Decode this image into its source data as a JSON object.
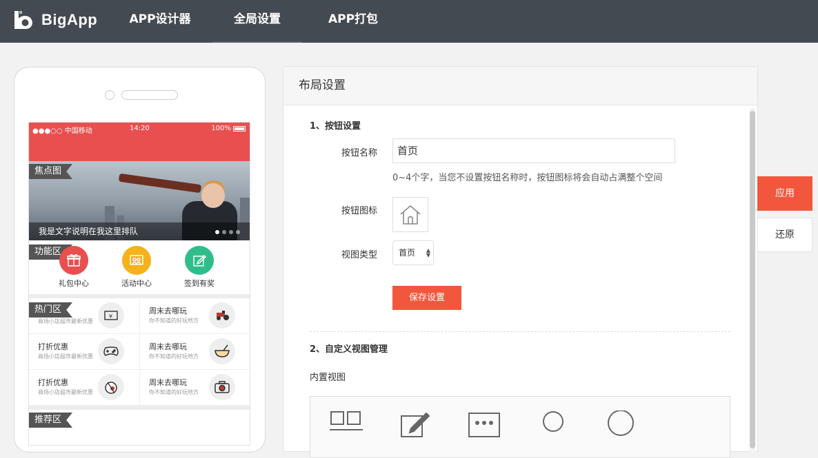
{
  "brand": {
    "name": "BigApp"
  },
  "nav": [
    {
      "label": "APP设计器",
      "active": false
    },
    {
      "label": "全局设置",
      "active": true
    },
    {
      "label": "APP打包",
      "active": false
    }
  ],
  "phone": {
    "status": {
      "carrier": "●●●○○ 中国移动",
      "time": "14:20",
      "battery": "100%"
    },
    "banner": {
      "tag": "焦点图",
      "caption": "我是文字说明在我这里排队",
      "dots": 4,
      "active_dot": 1
    },
    "func": {
      "tag": "功能区",
      "items": [
        {
          "label": "礼包中心",
          "color": "#e94f4f",
          "icon": "gift-icon"
        },
        {
          "label": "活动中心",
          "color": "#f5b21a",
          "icon": "people-icon"
        },
        {
          "label": "签到有奖",
          "color": "#2fbd8a",
          "icon": "edit-icon"
        }
      ]
    },
    "hot": {
      "tag": "热门区",
      "cells": [
        {
          "title": "",
          "sub": "商场小店超市最新优惠",
          "icon": "ticket-icon"
        },
        {
          "title": "周末去哪玩",
          "sub": "你不知道的好玩地方",
          "icon": "tractor-icon"
        },
        {
          "title": "打折优惠",
          "sub": "商场小店超市最新优惠",
          "icon": "gamepad-icon"
        },
        {
          "title": "周末去哪玩",
          "sub": "你不知道的好玩地方",
          "icon": "bowl-icon"
        },
        {
          "title": "打折优惠",
          "sub": "商场小店超市最新优惠",
          "icon": "pig-icon"
        },
        {
          "title": "周末去哪玩",
          "sub": "你不知道的好玩地方",
          "icon": "camera-icon"
        }
      ]
    },
    "recommend": {
      "tag": "推荐区"
    }
  },
  "panel": {
    "title": "布局设置",
    "section1": {
      "title": "1、按钮设置",
      "name_label": "按钮名称",
      "name_value": "首页",
      "hint": "0~4个字，当您不设置按钮名称时，按钮图标将会自动占满整个空间",
      "icon_label": "按钮图标",
      "icon": "home-icon",
      "view_label": "视图类型",
      "view_value": "首页",
      "save": "保存设置"
    },
    "section2": {
      "title": "2、自定义视图管理",
      "builtin_label": "内置视图",
      "icons": [
        "grid-icon",
        "edit-icon",
        "more-icon",
        "user-icon",
        "user-icon"
      ]
    }
  },
  "side": {
    "apply": "应用",
    "reset": "还原"
  },
  "colors": {
    "topbar": "#444a52",
    "accent": "#f2573d",
    "phone_status": "#e94f4f"
  }
}
